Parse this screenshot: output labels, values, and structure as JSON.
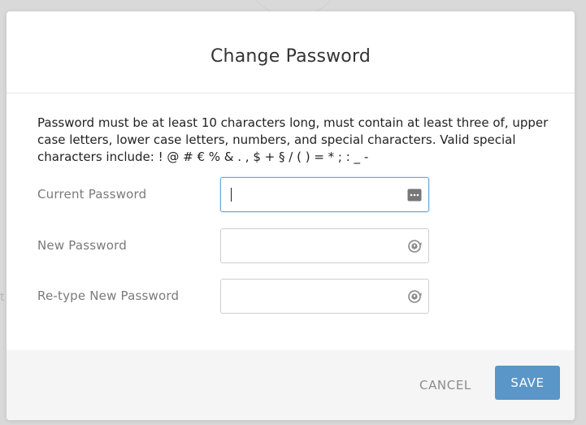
{
  "dialog": {
    "title": "Change Password",
    "instructions": "Password must be at least 10 characters long, must contain at least three of, upper case letters, lower case letters, numbers, and special characters. Valid special characters include: ! @ # € % & . , $ + § / ( ) = * ; : _ -",
    "fields": [
      {
        "label": "Current Password",
        "value": "",
        "placeholder": "",
        "icon": "password-dots-icon",
        "focused": true
      },
      {
        "label": "New Password",
        "value": "",
        "placeholder": "",
        "icon": "password-generate-icon",
        "focused": false
      },
      {
        "label": "Re-type New Password",
        "value": "",
        "placeholder": "",
        "icon": "password-generate-icon",
        "focused": false
      }
    ],
    "buttons": {
      "cancel": "CANCEL",
      "save": "SAVE"
    },
    "colors": {
      "primary": "#5a96c8",
      "focus_border": "#6aa5d8",
      "label": "#7a7a7a"
    }
  }
}
